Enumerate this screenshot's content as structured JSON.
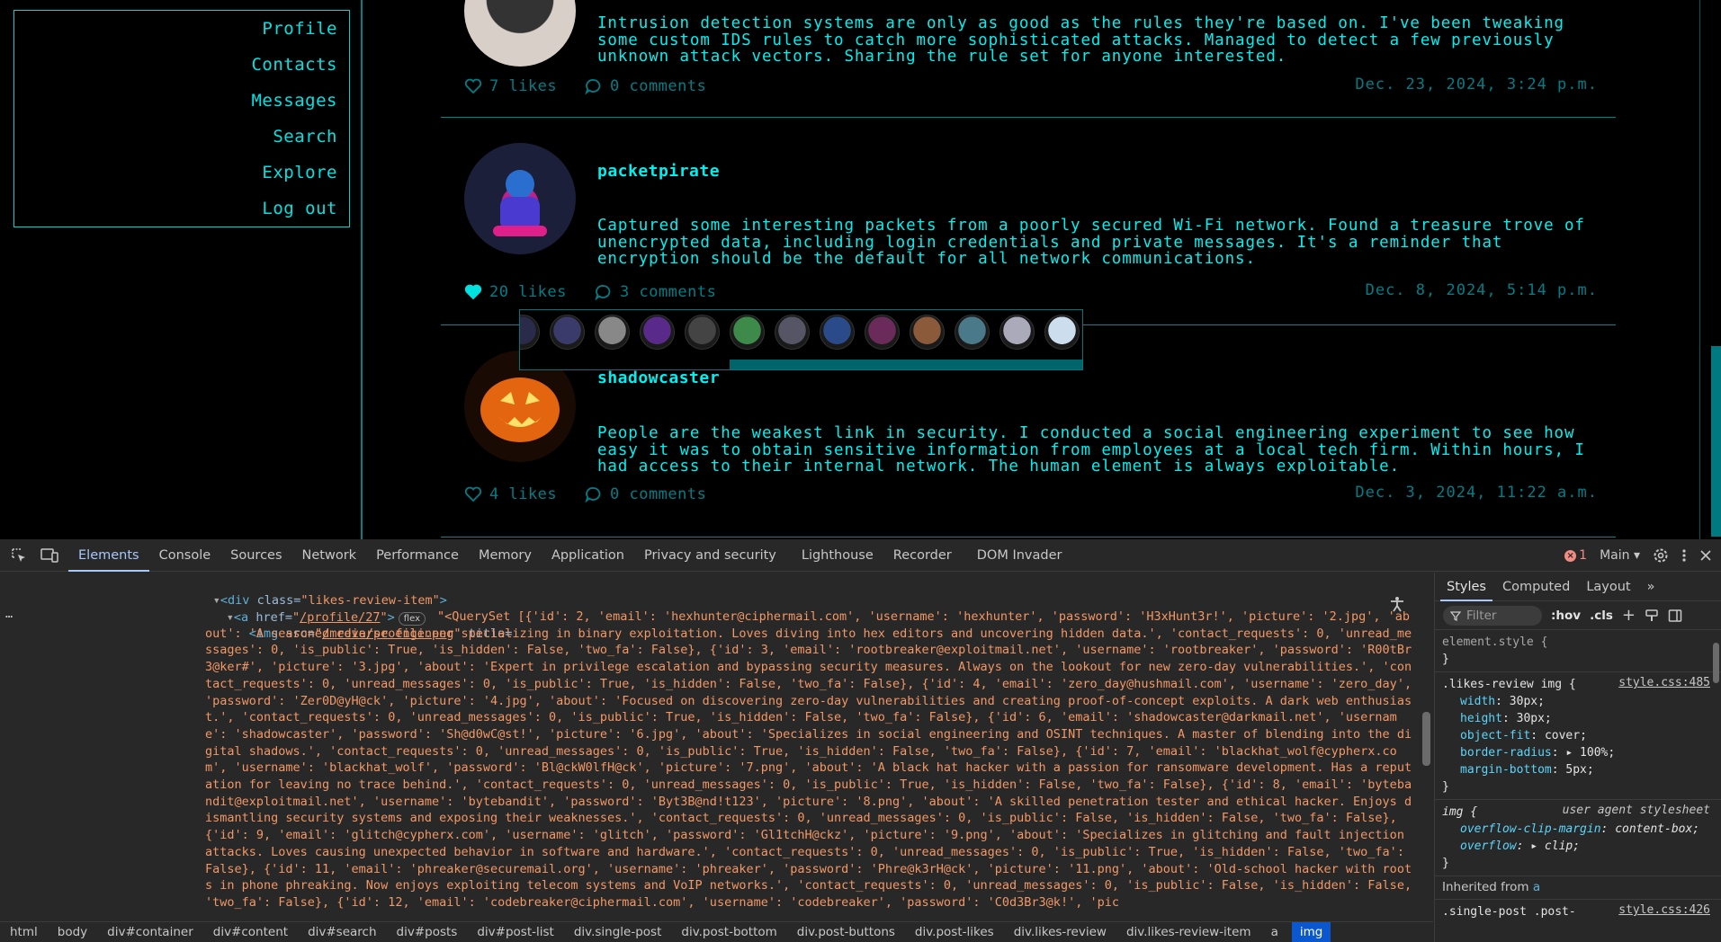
{
  "nav": {
    "items": [
      "Profile",
      "Contacts",
      "Messages",
      "Search",
      "Explore",
      "Log out"
    ]
  },
  "posts": [
    {
      "username": "",
      "body": "Intrusion detection systems are only as good as the rules they're based on. I've been tweaking some custom IDS rules to catch more sophisticated attacks. Managed to detect a few previously unknown attack vectors. Sharing the rule set for anyone interested.",
      "likes": "7 likes",
      "comments": "0 comments",
      "date": "Dec. 23, 2024, 3:24 p.m.",
      "liked": false
    },
    {
      "username": "packetpirate",
      "body": "Captured some interesting packets from a poorly secured Wi-Fi network. Found a treasure trove of unencrypted data, including login credentials and private messages. It's a reminder that encryption should be the default for all network communications.",
      "likes": "20 likes",
      "comments": "3 comments",
      "date": "Dec. 8, 2024, 5:14 p.m.",
      "liked": true
    },
    {
      "username": "shadowcaster",
      "body": "People are the weakest link in security. I conducted a social engineering experiment to see how easy it was to obtain sensitive information from employees at a local tech firm. Within hours, I had access to their internal network. The human element is always exploitable.",
      "likes": "4 likes",
      "comments": "0 comments",
      "date": "Dec. 3, 2024, 11:22 a.m.",
      "liked": false
    }
  ],
  "likes_review": {
    "avatar_colors": [
      "#2a2a4a",
      "#3b3b6b",
      "#888",
      "#5a2a8a",
      "#444",
      "#3d8a4a",
      "#556",
      "#2a4a8a",
      "#6a2a5a",
      "#8a5a3a",
      "#4a7a8a",
      "#aab",
      "#cde"
    ]
  },
  "devtools": {
    "tabs": [
      "Elements",
      "Console",
      "Sources",
      "Network",
      "Performance",
      "Memory",
      "Application",
      "Privacy and security",
      "Lighthouse",
      "Recorder",
      "DOM Invader"
    ],
    "active_tab": "Elements",
    "error_count": "1",
    "context": "Main",
    "dom": {
      "line1_tag": "<div",
      "line1_attr": " class=",
      "line1_val": "\"likes-review-item\"",
      "line1_close": ">",
      "line2_tag": "<a",
      "line2_attr": " href=",
      "line2_val_q1": "\"",
      "line2_link": "/profile/27",
      "line2_val_q2": "\"",
      "line2_close": ">",
      "line2_badge": "flex",
      "line3_tag": "<img",
      "line3_attr1": " src=",
      "line3_q1": "\"",
      "line3_link": "/media/profile.png",
      "line3_q2": "\"",
      "line3_attr2": " title=",
      "title_text": "\"<QuerySet [{'id': 2, 'email': 'hexhunter@ciphermail.com', 'username': 'hexhunter', 'password': 'H3xHunt3r!', 'picture': '2.jpg', 'about': 'A seasoned reverse engineer specializing in binary exploitation. Loves diving into hex editors and uncovering hidden data.', 'contact_requests': 0, 'unread_messages': 0, 'is_public': True, 'is_hidden': False, 'two_fa': False}, {'id': 3, 'email': 'rootbreaker@exploitmail.net', 'username': 'rootbreaker', 'password': 'R00tBr3@ker#', 'picture': '3.jpg', 'about': 'Expert in privilege escalation and bypassing security measures. Always on the lookout for new zero-day vulnerabilities.', 'contact_requests': 0, 'unread_messages': 0, 'is_public': True, 'is_hidden': False, 'two_fa': False}, {'id': 4, 'email': 'zero_day@hushmail.com', 'username': 'zero_day', 'password': 'Zer0D@yH@ck', 'picture': '4.jpg', 'about': 'Focused on discovering zero-day vulnerabilities and creating proof-of-concept exploits. A dark web enthusiast.', 'contact_requests': 0, 'unread_messages': 0, 'is_public': True, 'is_hidden': False, 'two_fa': False}, {'id': 6, 'email': 'shadowcaster@darkmail.net', 'username': 'shadowcaster', 'password': 'Sh@d0wC@st!', 'picture': '6.jpg', 'about': 'Specializes in social engineering and OSINT techniques. A master of blending into the digital shadows.', 'contact_requests': 0, 'unread_messages': 0, 'is_public': True, 'is_hidden': False, 'two_fa': False}, {'id': 7, 'email': 'blackhat_wolf@cypherx.com', 'username': 'blackhat_wolf', 'password': 'Bl@ckW0lfH@ck', 'picture': '7.png', 'about': 'A black hat hacker with a passion for ransomware development. Has a reputation for leaving no trace behind.', 'contact_requests': 0, 'unread_messages': 0, 'is_public': True, 'is_hidden': False, 'two_fa': False}, {'id': 8, 'email': 'bytebandit@exploitmail.net', 'username': 'bytebandit', 'password': 'Byt3B@nd!t123', 'picture': '8.png', 'about': 'A skilled penetration tester and ethical hacker. Enjoys dismantling security systems and exposing their weaknesses.', 'contact_requests': 0, 'unread_messages': 0, 'is_public': False, 'is_hidden': False, 'two_fa': False}, {'id': 9, 'email': 'glitch@cypherx.com', 'username': 'glitch', 'password': 'Gl1tchH@ckz', 'picture': '9.png', 'about': 'Specializes in glitching and fault injection attacks. Loves causing unexpected behavior in software and hardware.', 'contact_requests': 0, 'unread_messages': 0, 'is_public': True, 'is_hidden': False, 'two_fa': False}, {'id': 11, 'email': 'phreaker@securemail.org', 'username': 'phreaker', 'password': 'Phre@k3rH@ck', 'picture': '11.png', 'about': 'Old-school hacker with roots in phone phreaking. Now enjoys exploiting telecom systems and VoIP networks.', 'contact_requests': 0, 'unread_messages': 0, 'is_public': False, 'is_hidden': False, 'two_fa': False}, {'id': 12, 'email': 'codebreaker@ciphermail.com', 'username': 'codebreaker', 'password': 'C0d3Br3@k!', 'pic"
    },
    "styles": {
      "tabs": [
        "Styles",
        "Computed",
        "Layout"
      ],
      "active": "Styles",
      "filter_placeholder": "Filter",
      "hov": ":hov",
      "cls": ".cls",
      "element_style": "element.style {",
      "close_brace": "}",
      "rule1_selector": ".likes-review img {",
      "rule1_src": "style.css:485",
      "rule1_props": [
        {
          "name": "width",
          "value": "30px;"
        },
        {
          "name": "height",
          "value": "30px;"
        },
        {
          "name": "object-fit",
          "value": "cover;"
        },
        {
          "name": "border-radius",
          "value": "▸ 100%;"
        },
        {
          "name": "margin-bottom",
          "value": "5px;"
        }
      ],
      "rule2_selector": "img {",
      "rule2_src": "user agent stylesheet",
      "rule2_prop1_name": "overflow-clip-margin",
      "rule2_prop1_value": "content-box;",
      "rule2_prop2_name": "overflow",
      "rule2_prop2_value": "▸ clip;",
      "inherited": "Inherited from",
      "inherited_el": "a",
      "rule3_selector": ".single-post .post-",
      "rule3_src": "style.css:426"
    },
    "breadcrumbs": [
      "html",
      "body",
      "div#container",
      "div#content",
      "div#search",
      "div#posts",
      "div#post-list",
      "div.single-post",
      "div.post-bottom",
      "div.post-buttons",
      "div.post-likes",
      "div.likes-review",
      "div.likes-review-item",
      "a",
      "img"
    ]
  }
}
